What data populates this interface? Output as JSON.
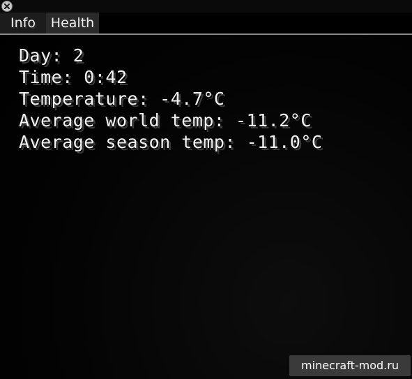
{
  "window": {
    "close_icon": "close-x-icon"
  },
  "tabs": [
    {
      "label": "Info",
      "active": true
    },
    {
      "label": "Health",
      "active": false
    }
  ],
  "info": {
    "lines": [
      "Day: 2",
      "Time: 0:42",
      "Temperature: -4.7°C",
      "Average world temp: -11.2°C",
      "Average season temp: -11.0°C"
    ]
  },
  "watermark": "minecraft-mod.ru",
  "colors": {
    "background": "#000000",
    "text": "#f4f4f4",
    "tab_info_bg": "#1c1c1c",
    "tab_health_bg": "#2a2a2a",
    "divider": "#8a8a8a"
  }
}
